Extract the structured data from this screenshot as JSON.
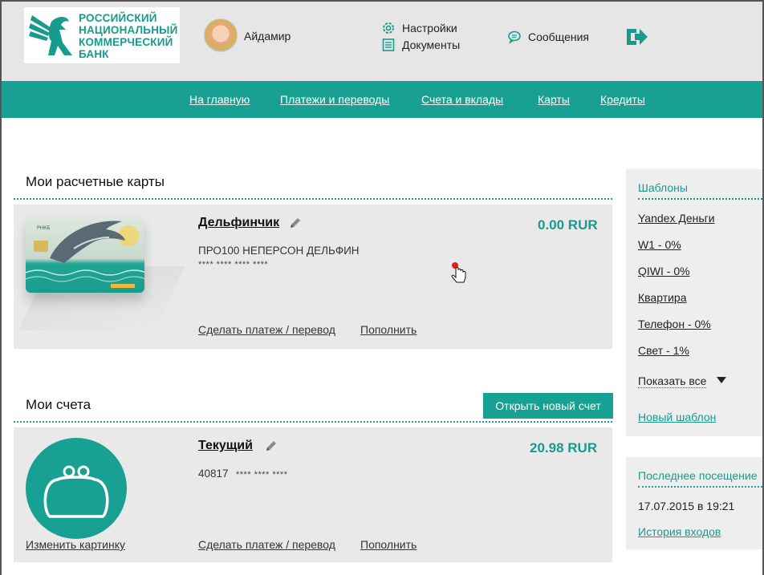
{
  "header": {
    "logo_lines": [
      "РОССИЙСКИЙ",
      "НАЦИОНАЛЬНЫЙ",
      "КОММЕРЧЕСКИЙ",
      "БАНК"
    ],
    "user_name": "Айдамир",
    "settings_label": "Настройки",
    "documents_label": "Документы",
    "messages_label": "Сообщения"
  },
  "nav": {
    "items": [
      "На главную",
      "Платежи и переводы",
      "Счета и вклады",
      "Карты",
      "Кредиты"
    ]
  },
  "cards_section": {
    "title": "Мои расчетные карты",
    "card": {
      "name": "Дельфинчик",
      "amount": "0.00 RUR",
      "holder": "ПРО100 НЕПЕРСОН ДЕЛЬФИН",
      "number_mask": "**** **** **** ****",
      "pay_link": "Сделать платеж / перевод",
      "topup_link": "Пополнить"
    }
  },
  "accounts_section": {
    "title": "Мои счета",
    "open_button": "Открыть новый счет",
    "account": {
      "name": "Текущий",
      "amount": "20.98 RUR",
      "number_prefix": "40817",
      "number_mask": "**** **** ****",
      "change_image_link": "Изменить картинку",
      "pay_link": "Сделать платеж / перевод",
      "topup_link": "Пополнить"
    }
  },
  "templates": {
    "title": "Шаблоны",
    "items": [
      "Yandex Деньги",
      "W1 - 0%",
      "QIWI - 0%",
      "Квартира",
      "Телефон - 0%",
      "Свет - 1%"
    ],
    "show_all": "Показать все",
    "new_template": "Новый шаблон"
  },
  "last_visit": {
    "title": "Последнее посещение",
    "datetime": "17.07.2015 в 19:21",
    "history_link": "История входов"
  },
  "colors": {
    "accent": "#18a193",
    "accent_text": "#169b8c"
  }
}
